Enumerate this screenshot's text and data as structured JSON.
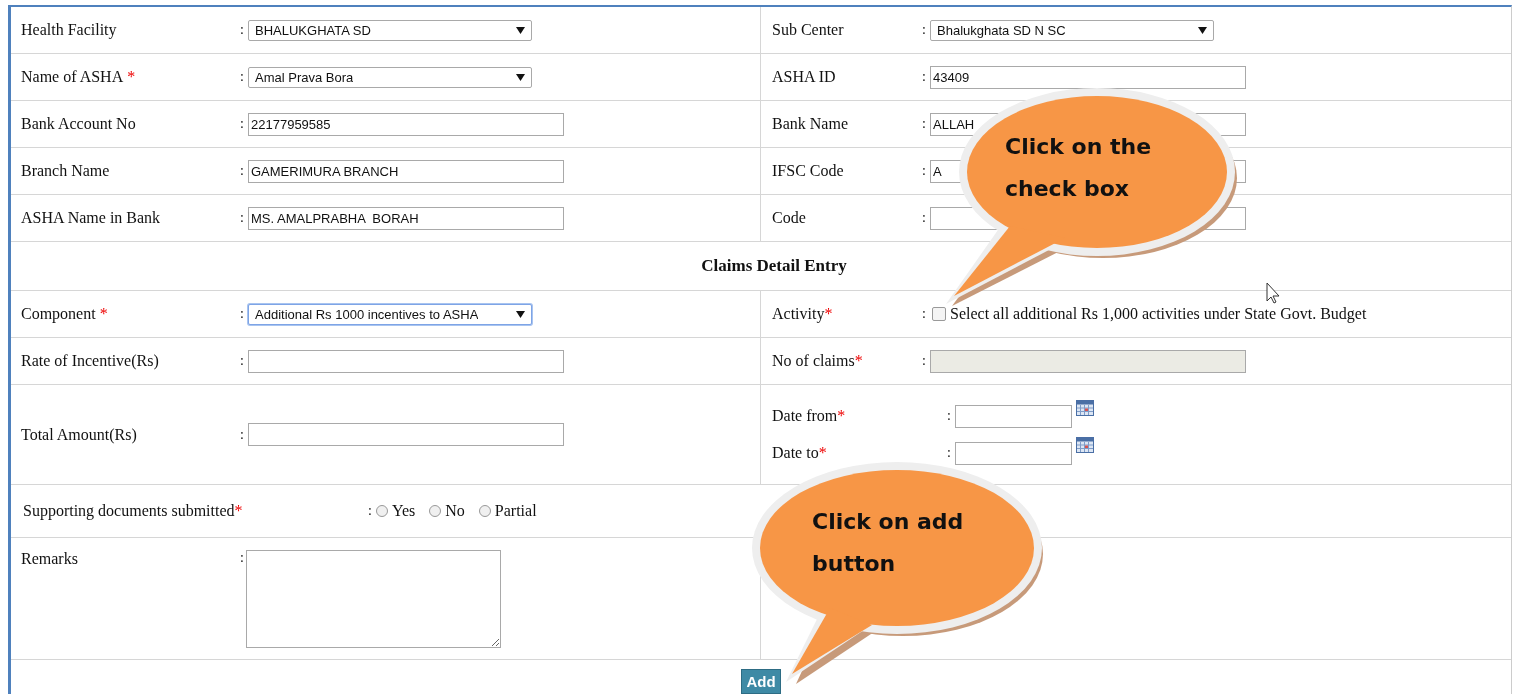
{
  "personal_rows": [
    {
      "left": {
        "label": "Health Facility",
        "colon": ":",
        "control": {
          "kind": "select",
          "value": "BHALUKGHATA SD"
        }
      },
      "right": {
        "label": "Sub Center",
        "colon": ":",
        "control": {
          "kind": "select",
          "value": "Bhalukghata SD N SC"
        }
      }
    },
    {
      "left": {
        "label": "Name of ASHA",
        "required_mark": "*",
        "colon": ":",
        "control": {
          "kind": "select",
          "value": "Amal Prava Bora"
        }
      },
      "right": {
        "label": "ASHA ID",
        "colon": ":",
        "control": {
          "kind": "input",
          "value": "43409"
        }
      }
    },
    {
      "left": {
        "label": "Bank Account No",
        "colon": ":",
        "control": {
          "kind": "input",
          "value": "22177959585"
        }
      },
      "right": {
        "label": "Bank Name",
        "colon": ":",
        "control": {
          "kind": "input",
          "value": "ALLAH"
        }
      }
    },
    {
      "left": {
        "label": "Branch Name",
        "colon": ":",
        "control": {
          "kind": "input",
          "value": "GAMERIMURA BRANCH"
        }
      },
      "right": {
        "label": "IFSC Code",
        "colon": ":",
        "control": {
          "kind": "input",
          "value": "A"
        }
      }
    },
    {
      "left": {
        "label": "ASHA Name in Bank",
        "colon": ":",
        "control": {
          "kind": "input",
          "value": "MS. AMALPRABHA  BORAH"
        }
      },
      "right": {
        "label": "Code",
        "colon": ":",
        "control": {
          "kind": "input"
        }
      }
    }
  ],
  "claims_heading": "Claims Detail Entry",
  "claim_rows": [
    {
      "left": {
        "label": "Component",
        "required_mark": "*",
        "colon": ":",
        "control": {
          "kind": "select",
          "value": "Additional Rs 1000 incentives to ASHA",
          "focused": true
        }
      },
      "right": {
        "label": "Activity",
        "required_mark": "*",
        "colon": ":",
        "control": {
          "kind": "checkbox",
          "text": "Select all additional Rs 1,000 activities under State Govt. Budget",
          "checked": false
        }
      }
    },
    {
      "left": {
        "label": "Rate of Incentive(Rs)",
        "colon": ":",
        "control": {
          "kind": "input"
        }
      },
      "right": {
        "label": "No of claims",
        "required_mark": "*",
        "colon": ":",
        "control": {
          "kind": "input",
          "disabled": true
        }
      }
    }
  ],
  "total_row": {
    "left": {
      "label": "Total Amount(Rs)",
      "colon": ":",
      "control": {
        "kind": "input"
      }
    },
    "dates": [
      {
        "label": "Date from",
        "required_mark": "*",
        "colon": ":"
      },
      {
        "label": "Date to",
        "required_mark": "*",
        "colon": ":"
      }
    ]
  },
  "supporting": {
    "label": "Supporting documents submitted",
    "required_mark": "*",
    "colon": ":",
    "options": [
      {
        "label": "Yes",
        "selected": false
      },
      {
        "label": "No",
        "selected": false
      },
      {
        "label": "Partial",
        "selected": false
      }
    ]
  },
  "remarks": {
    "label": "Remarks",
    "colon": ":"
  },
  "add_button": "Add",
  "callouts": [
    {
      "text": "Click on the check box"
    },
    {
      "text": "Click on add button"
    }
  ]
}
